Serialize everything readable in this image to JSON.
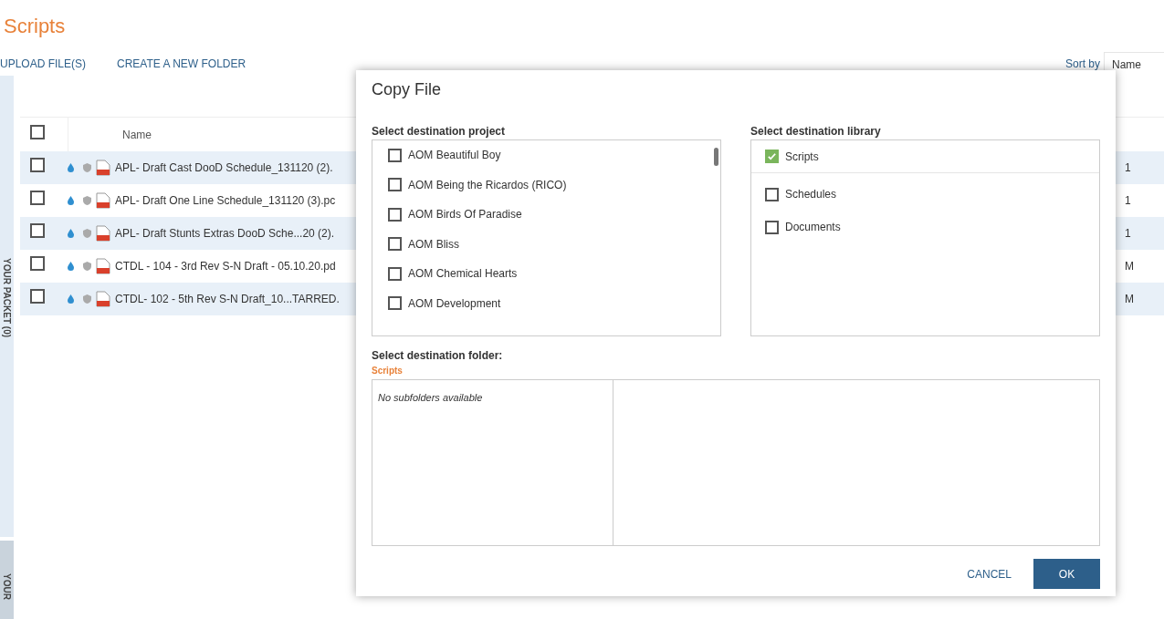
{
  "page": {
    "title": "Scripts",
    "actions": [
      "UPLOAD FILE(S)",
      "CREATE A NEW FOLDER"
    ],
    "sort": {
      "label": "Sort by",
      "value": "Name"
    }
  },
  "side_tabs": [
    "YOUR PACKET (0)",
    "YOUR"
  ],
  "table": {
    "columns": [
      "Name"
    ],
    "all_checked": false,
    "rows": [
      {
        "name": "APL- Draft Cast DooD Schedule_131120 (2).",
        "column_2": "1",
        "checked": false
      },
      {
        "name": "APL- Draft One Line Schedule_131120 (3).pc",
        "column_2": "1",
        "checked": false
      },
      {
        "name": "APL- Draft Stunts Extras DooD Sche...20 (2).",
        "column_2": "1",
        "checked": false
      },
      {
        "name": "CTDL - 104 - 3rd Rev S-N Draft - 05.10.20.pd",
        "column_2": "M",
        "checked": false
      },
      {
        "name": "CTDL- 102 - 5th Rev S-N Draft_10...TARRED.",
        "column_2": "M",
        "checked": false
      }
    ]
  },
  "dialog": {
    "title": "Copy File",
    "project": {
      "label": "Select destination project",
      "items": [
        {
          "label": "AOM Beautiful Boy",
          "checked": false
        },
        {
          "label": "AOM Being the Ricardos (RICO)",
          "checked": false
        },
        {
          "label": "AOM Birds Of Paradise",
          "checked": false
        },
        {
          "label": "AOM Bliss",
          "checked": false
        },
        {
          "label": "AOM Chemical Hearts",
          "checked": false
        },
        {
          "label": "AOM Development",
          "checked": false
        }
      ]
    },
    "library": {
      "label": "Select destination library",
      "items": [
        {
          "label": "Scripts",
          "checked": true
        },
        {
          "label": "Schedules",
          "checked": false
        },
        {
          "label": "Documents",
          "checked": false
        }
      ]
    },
    "folder": {
      "label": "Select destination folder:",
      "path": "Scripts",
      "empty_text": "No subfolders available"
    },
    "buttons": [
      {
        "label": "CANCEL",
        "kind": "secondary"
      },
      {
        "label": "OK",
        "kind": "primary"
      }
    ]
  }
}
